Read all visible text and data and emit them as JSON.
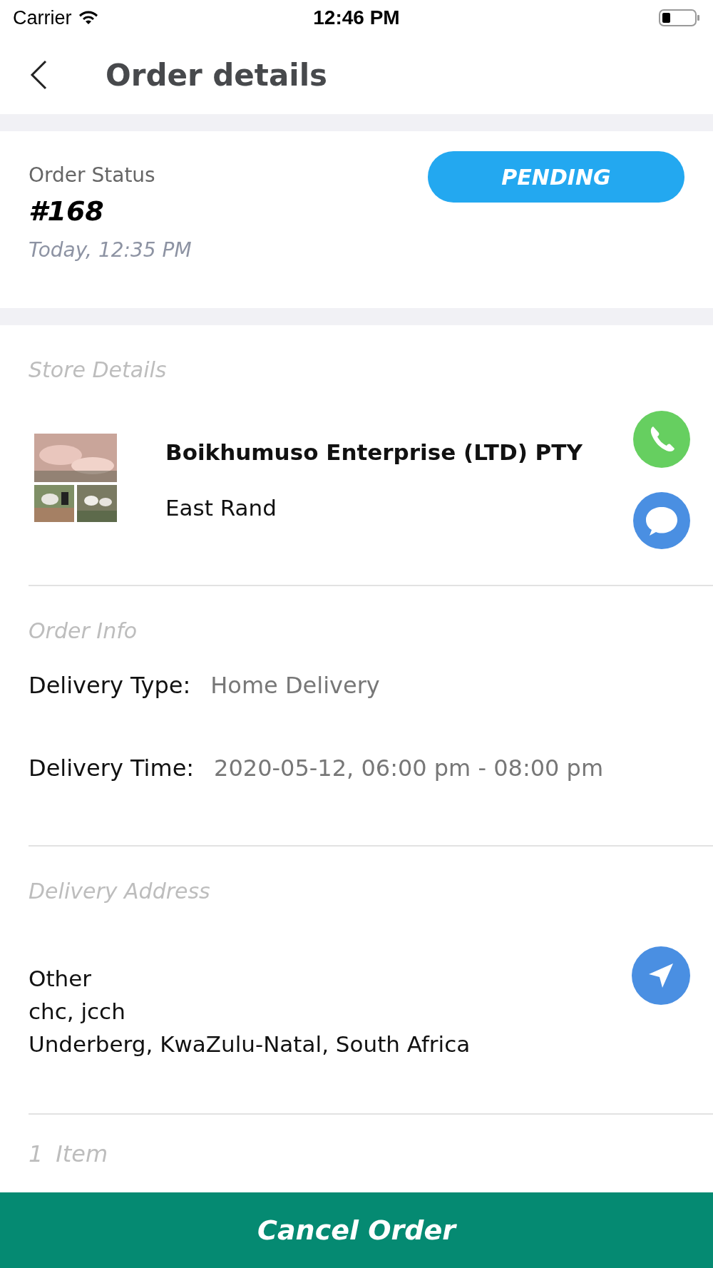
{
  "status_bar": {
    "carrier": "Carrier",
    "time": "12:46 PM"
  },
  "header": {
    "title": "Order details"
  },
  "order": {
    "label": "Order Status",
    "number": "#168",
    "date": "Today, 12:35 PM",
    "status": {
      "text": "PENDING",
      "kind": "pending"
    }
  },
  "store": {
    "heading": "Store Details",
    "name": "Boikhumuso Enterprise (LTD) PTY",
    "area": "East Rand"
  },
  "order_info": {
    "heading": "Order Info",
    "fields": [
      {
        "label": "Delivery Type:",
        "value": "Home Delivery"
      },
      {
        "label": "Delivery Time:",
        "value": "2020-05-12, 06:00 pm - 08:00 pm"
      }
    ]
  },
  "address": {
    "heading": "Delivery Address",
    "lines": [
      "Other",
      "chc, jcch",
      "Underberg, KwaZulu-Natal, South Africa"
    ]
  },
  "items": {
    "count": "1",
    "heading": "Item"
  },
  "footer_button": "Cancel Order"
}
